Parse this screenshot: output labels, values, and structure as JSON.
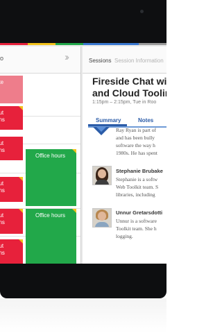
{
  "theme": {
    "colorbar": [
      "#e7213b",
      "#f2c21b",
      "#22a84a",
      "#3a78d0",
      "#3a78d0",
      "#9b9b9b"
    ],
    "session_red": "#e7213b",
    "session_green": "#22a84a",
    "accent_blue": "#2b5ca8"
  },
  "schedule": {
    "time_label": "o",
    "nav_icon": "double-chevron-right-icon",
    "blocks": {
      "pink_1": "ote",
      "red_1": [
        "out",
        "ons"
      ],
      "red_2": [
        "out",
        "ons"
      ],
      "green_1": "Office hours",
      "red_3": [
        "out",
        "ons"
      ],
      "green_2": "Office hours",
      "red_4": [
        "out",
        "ons"
      ],
      "red_5": [
        "out",
        "ons"
      ]
    }
  },
  "detail": {
    "tabs": {
      "sessions": "Sessions",
      "session_info": "Session Information"
    },
    "title_line1": "Fireside Chat wi",
    "title_line2": "and Cloud Toolin",
    "subtitle": "1:15pm – 2:15pm, Tue in Roo",
    "section_tabs": {
      "summary": "Summary",
      "notes": "Notes"
    },
    "speakers": [
      {
        "name": "",
        "lines": [
          "Ray Ryan is part of",
          "and has been bully",
          "software the way h",
          "1980s. He has spent"
        ]
      },
      {
        "name": "Stephanie Brubake",
        "lines": [
          "Stephanie is a softw",
          "Web Toolkit team. S",
          "libraries, including"
        ]
      },
      {
        "name": "Unnur Gretarsdotti",
        "lines": [
          "Unnur is a software",
          "Toolkit team. She h",
          "logging."
        ]
      }
    ]
  }
}
